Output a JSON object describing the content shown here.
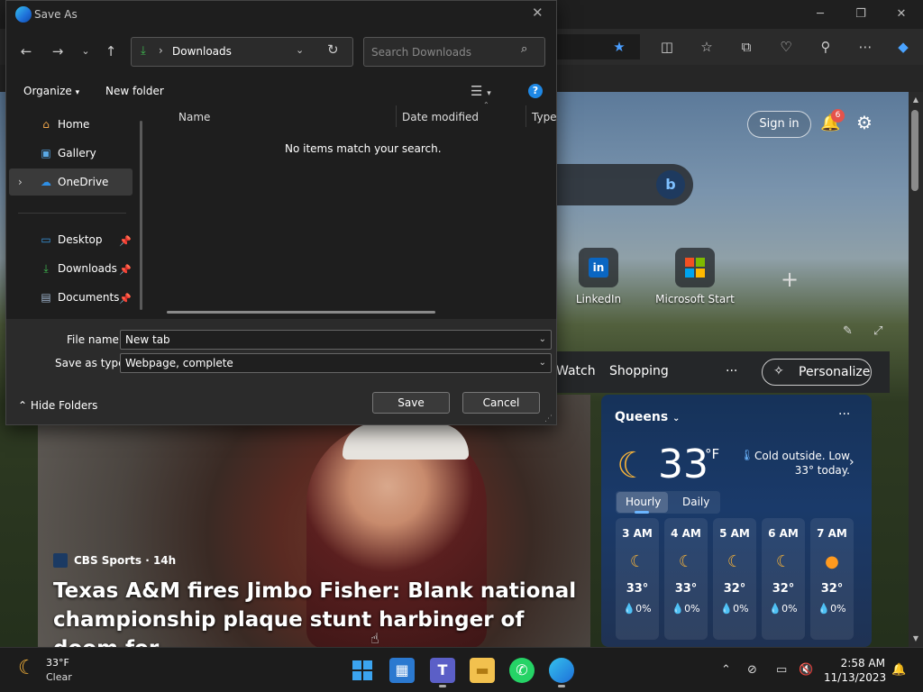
{
  "dialog": {
    "title": "Save As",
    "path": "Downloads",
    "search_placeholder": "Search Downloads",
    "organize": "Organize",
    "new_folder": "New folder",
    "nav_items": [
      {
        "label": "Home",
        "icon": "home-icon"
      },
      {
        "label": "Gallery",
        "icon": "gallery-icon"
      },
      {
        "label": "OneDrive",
        "icon": "onedrive-icon"
      },
      {
        "label": "Desktop",
        "icon": "desktop-icon"
      },
      {
        "label": "Downloads",
        "icon": "downloads-icon"
      },
      {
        "label": "Documents",
        "icon": "documents-icon"
      }
    ],
    "columns": [
      "Name",
      "Date modified",
      "Type"
    ],
    "empty_message": "No items match your search.",
    "file_name_label": "File name:",
    "file_name_value": "New tab",
    "save_type_label": "Save as type:",
    "save_type_value": "Webpage, complete",
    "save_button": "Save",
    "cancel_button": "Cancel",
    "hide_folders": "Hide Folders"
  },
  "browser": {
    "sign_in": "Sign in",
    "notification_count": "6",
    "quick_links": [
      {
        "label": "LinkedIn",
        "icon": "linkedin-icon"
      },
      {
        "label": "Microsoft Start",
        "icon": "microsoft-start-icon"
      }
    ],
    "feed_links": [
      "Watch",
      "Shopping"
    ],
    "feed_more": "···",
    "personalize": "Personalize"
  },
  "news": {
    "source": "CBS Sports · 14h",
    "headline": "Texas A&M fires Jimbo Fisher: Blank national championship plaque stunt harbinger of doom for..."
  },
  "weather": {
    "location": "Queens",
    "temperature": "33",
    "unit": "°F",
    "description": "Cold outside. Low 33° today.",
    "tabs": [
      "Hourly",
      "Daily"
    ],
    "hours": [
      {
        "time": "3 AM",
        "temp": "33°",
        "precip": "0%",
        "icon": "moon-icon"
      },
      {
        "time": "4 AM",
        "temp": "33°",
        "precip": "0%",
        "icon": "moon-icon"
      },
      {
        "time": "5 AM",
        "temp": "32°",
        "precip": "0%",
        "icon": "moon-icon"
      },
      {
        "time": "6 AM",
        "temp": "32°",
        "precip": "0%",
        "icon": "moon-icon"
      },
      {
        "time": "7 AM",
        "temp": "32°",
        "precip": "0%",
        "icon": "sun-icon"
      }
    ]
  },
  "taskbar": {
    "weather_temp": "33°F",
    "weather_desc": "Clear",
    "time": "2:58 AM",
    "date": "11/13/2023"
  },
  "colors": {
    "accent": "#1e88e5",
    "download_green": "#3fb950",
    "moon": "#f3b13a",
    "badge": "#e5534b"
  }
}
